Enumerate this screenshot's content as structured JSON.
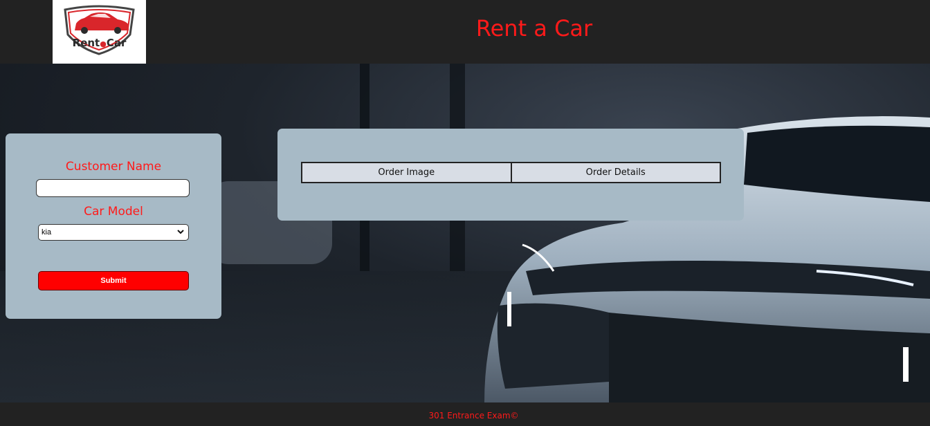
{
  "header": {
    "logo_text": "Rent",
    "logo_text_2": "Car",
    "title": "Rent a Car"
  },
  "form": {
    "customer_name_label": "Customer Name",
    "customer_name_value": "",
    "car_model_label": "Car Model",
    "car_model_selected": "kia",
    "submit_label": "Submit"
  },
  "orders": {
    "columns": [
      "Order Image",
      "Order Details"
    ]
  },
  "footer": {
    "text": "301 Entrance Exam©"
  },
  "colors": {
    "accent": "#ff1a1a",
    "panel": "#a7bac6",
    "bar": "#222222",
    "button": "#ff0000"
  },
  "icons": {
    "logo": "car-logo-icon",
    "select": "chevron-down-icon"
  }
}
